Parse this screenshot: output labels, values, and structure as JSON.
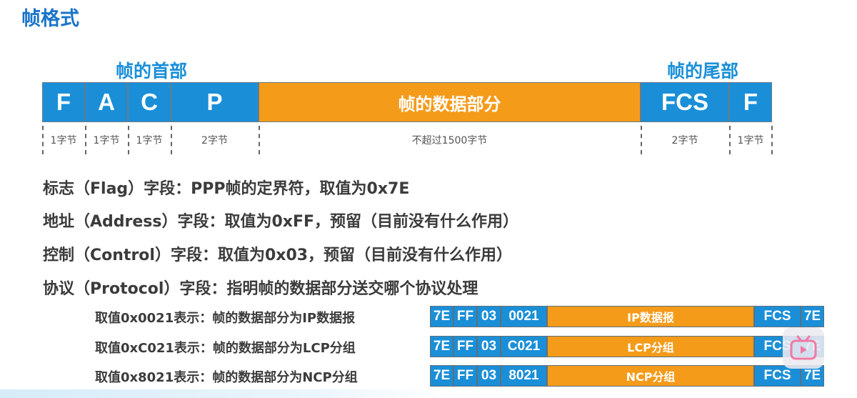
{
  "title": "帧格式",
  "labels": {
    "header": "帧的首部",
    "trailer": "帧的尾部"
  },
  "frame": [
    {
      "label": "F",
      "size": "1字节",
      "kind": "blue"
    },
    {
      "label": "A",
      "size": "1字节",
      "kind": "blue"
    },
    {
      "label": "C",
      "size": "1字节",
      "kind": "blue"
    },
    {
      "label": "P",
      "size": "2字节",
      "kind": "blue"
    },
    {
      "label": "帧的数据部分",
      "size": "不超过1500字节",
      "kind": "orange"
    },
    {
      "label": "FCS",
      "size": "2字节",
      "kind": "blue"
    },
    {
      "label": "F",
      "size": "1字节",
      "kind": "blue"
    }
  ],
  "descriptions": [
    "标志（Flag）字段：PPP帧的定界符，取值为0x7E",
    "地址（Address）字段：取值为0xFF，预留（目前没有什么作用）",
    "控制（Control）字段：取值为0x03，预留（目前没有什么作用）",
    "协议（Protocol）字段：指明帧的数据部分送交哪个协议处理"
  ],
  "protocols": [
    {
      "text": "取值0x0021表示：帧的数据部分为IP数据报",
      "cells": [
        "7E",
        "FF",
        "03",
        "0021",
        "IP数据报",
        "FCS",
        "7E"
      ]
    },
    {
      "text": "取值0xC021表示：帧的数据部分为LCP分组",
      "cells": [
        "7E",
        "FF",
        "03",
        "C021",
        "LCP分组",
        "FCS",
        "7E"
      ]
    },
    {
      "text": "取值0x8021表示：帧的数据部分为NCP分组",
      "cells": [
        "7E",
        "FF",
        "03",
        "8021",
        "NCP分组",
        "FCS",
        "7E"
      ]
    }
  ],
  "colors": {
    "blue": "#1a8fd8",
    "orange": "#f59b1a",
    "title": "#1a74c9"
  },
  "overlay_icon": "bilibili-tv-icon"
}
